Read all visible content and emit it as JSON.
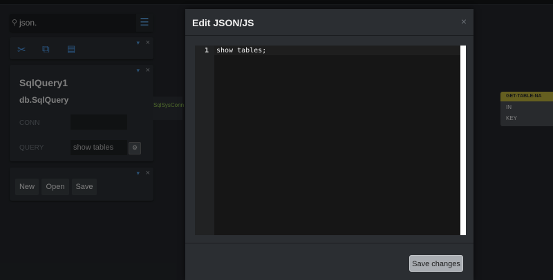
{
  "search": {
    "value": "json.",
    "icon": "search-icon",
    "menu_icon": "hamburger-menu-icon"
  },
  "toolbar": {
    "icons": [
      "scissors-cut-icon",
      "copy-icon",
      "paste-icon"
    ],
    "cut_glyph": "✂",
    "copy_glyph": "⧉",
    "paste_glyph": "📋"
  },
  "panel_controls": {
    "pin_glyph": "📌",
    "close_glyph": "×"
  },
  "properties": {
    "name": "SqlQuery1",
    "type": "db.SqlQuery",
    "conn_label": "CONN",
    "conn_value": "",
    "query_label": "QUERY",
    "query_value": "show tables",
    "edit_glyph": "⚙"
  },
  "actions": {
    "new_label": "New",
    "open_label": "Open",
    "save_label": "Save"
  },
  "canvas": {
    "green_tag": "SqlSysConn",
    "node": {
      "title": "GET-TABLE-NA",
      "ports": [
        "IN",
        "KEY"
      ]
    }
  },
  "modal": {
    "title": "Edit JSON/JS",
    "close_glyph": "×",
    "line_number": "1",
    "code": "show tables;",
    "save_label": "Save changes"
  }
}
